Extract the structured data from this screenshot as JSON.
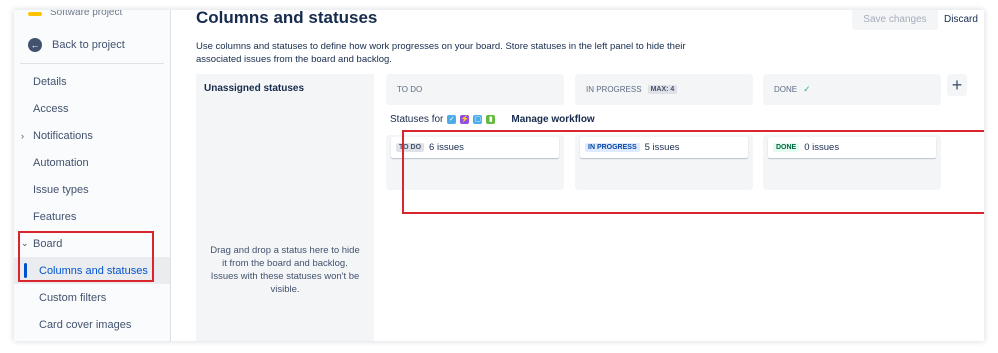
{
  "sidebar": {
    "project_type": "Software project",
    "back_label": "Back to project",
    "items": [
      {
        "label": "Details"
      },
      {
        "label": "Access"
      },
      {
        "label": "Notifications"
      },
      {
        "label": "Automation"
      },
      {
        "label": "Issue types"
      },
      {
        "label": "Features"
      },
      {
        "label": "Board"
      },
      {
        "label": "Columns and statuses"
      },
      {
        "label": "Custom filters"
      },
      {
        "label": "Card cover images"
      }
    ]
  },
  "header": {
    "title": "Columns and statuses",
    "save_label": "Save changes",
    "discard_label": "Discard"
  },
  "description": "Use columns and statuses to define how work progresses on your board. Store statuses in the left panel to hide their associated issues from the board and backlog.",
  "unassigned": {
    "title": "Unassigned statuses",
    "hint": "Drag and drop a status here to hide it from the board and backlog. Issues with these statuses won't be visible."
  },
  "columns": [
    {
      "name": "TO DO",
      "max": "",
      "status": "TO DO",
      "count": "6 issues"
    },
    {
      "name": "IN PROGRESS",
      "max": "MAX: 4",
      "status": "IN PROGRESS",
      "count": "5 issues"
    },
    {
      "name": "DONE",
      "max": "",
      "status": "DONE",
      "count": "0 issues"
    }
  ],
  "add_column_label": "+",
  "statuses_for_label": "Statuses for",
  "manage_workflow_label": "Manage workflow",
  "colors": {
    "accent": "#0052cc",
    "highlight": "#d9252d",
    "todo_lozenge_bg": "#dfe1e6",
    "inprogress_lozenge_bg": "#deebff",
    "done_lozenge_bg": "#e3fcef"
  },
  "icons": [
    "back-arrow-icon",
    "chevron-right-icon",
    "chevron-down-icon",
    "plus-icon",
    "checkmark-icon",
    "task-type-icon",
    "subtask-type-icon",
    "story-type-icon"
  ]
}
